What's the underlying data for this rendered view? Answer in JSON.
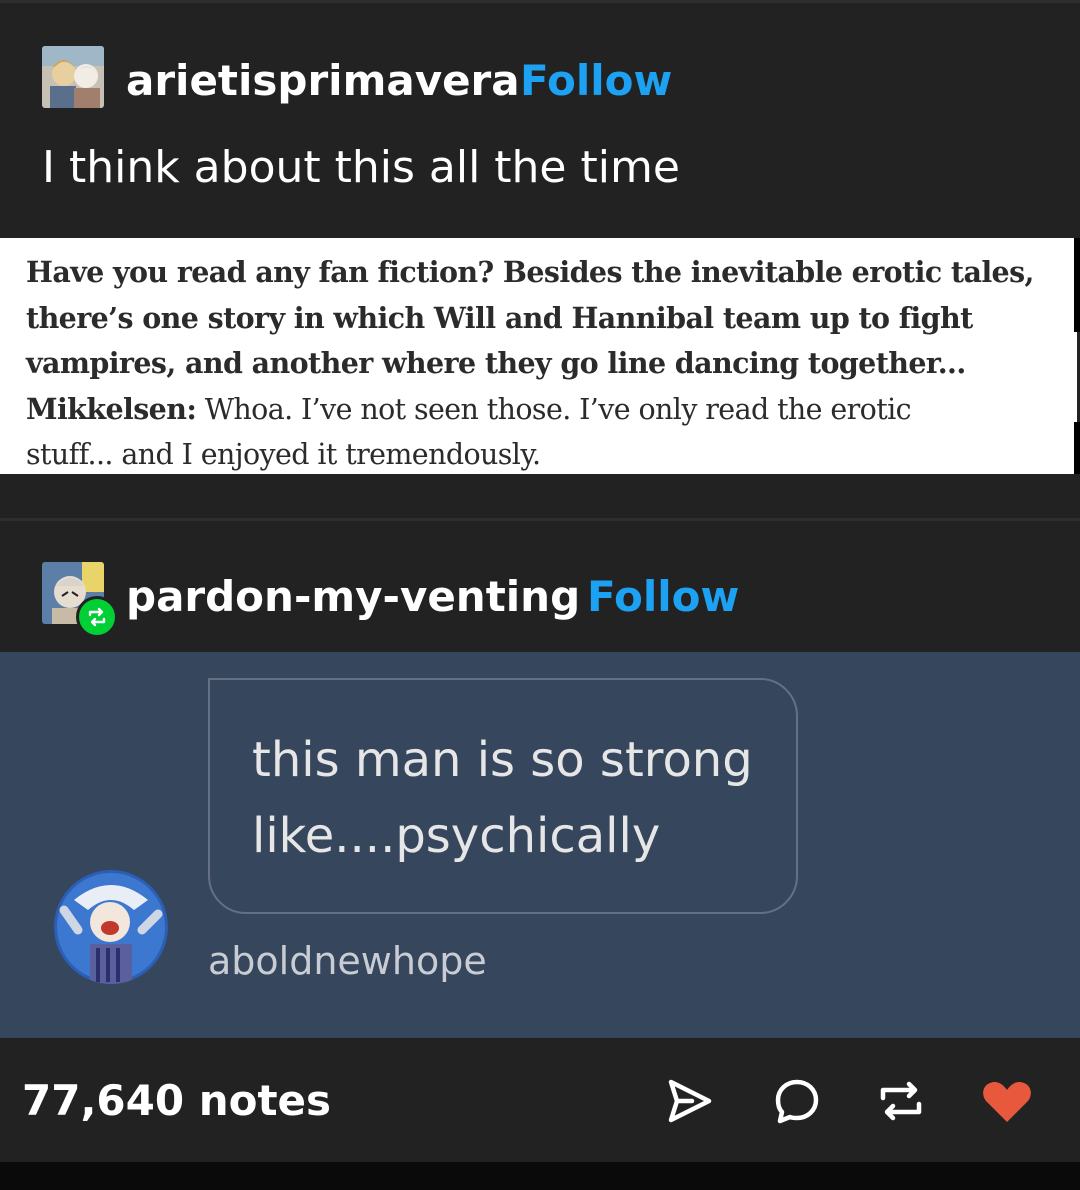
{
  "post1": {
    "username": "arietisprimavera",
    "follow_label": "Follow",
    "caption": "I think about this all the time",
    "excerpt": {
      "line1": "Have you read any fan fiction? Besides the inevitable erotic tales,",
      "line2": "there’s one story in which Will and Hannibal team up to fight",
      "line3": "vampires, and another where they go line dancing together...",
      "speaker": "Mikkelsen:",
      "line4_rest": " Whoa. I’ve not seen those. I’ve only read the erotic",
      "line5": "stuff... and I enjoyed it tremendously."
    }
  },
  "post2": {
    "username": "pardon-my-venting",
    "follow_label": "Follow",
    "message": {
      "line1": "this man is so strong",
      "line2": "like....psychically"
    },
    "sender": "aboldnewhope"
  },
  "footer": {
    "notes": "77,640 notes",
    "icons": [
      "share-icon",
      "comment-icon",
      "reblog-icon",
      "like-icon"
    ]
  },
  "colors": {
    "follow": "#1da1f2",
    "reblog_green": "#00cf35",
    "body_blue": "#36465d",
    "like_red": "#e8583c"
  }
}
